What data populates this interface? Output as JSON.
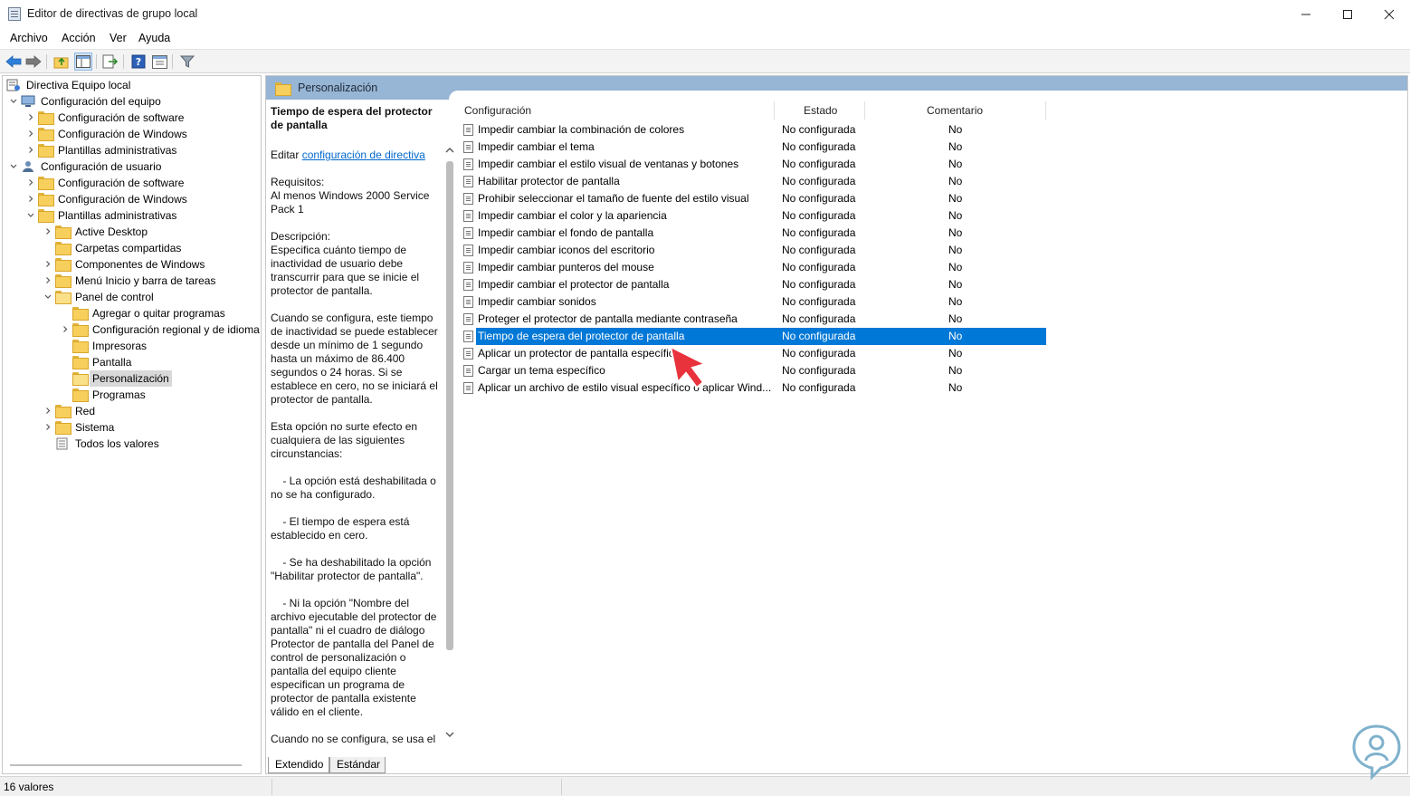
{
  "window": {
    "title": "Editor de directivas de grupo local"
  },
  "menu": [
    "Archivo",
    "Acción",
    "Ver",
    "Ayuda"
  ],
  "tree": [
    {
      "label": "Directiva Equipo local",
      "level": 0,
      "chevron": "",
      "icon": "policy-computer-icon"
    },
    {
      "label": "Configuración del equipo",
      "level": 1,
      "chevron": "down",
      "icon": "computer-icon"
    },
    {
      "label": "Configuración de software",
      "level": 2,
      "chevron": "right",
      "icon": "folder-icon"
    },
    {
      "label": "Configuración de Windows",
      "level": 2,
      "chevron": "right",
      "icon": "folder-icon"
    },
    {
      "label": "Plantillas administrativas",
      "level": 2,
      "chevron": "right",
      "icon": "folder-icon"
    },
    {
      "label": "Configuración de usuario",
      "level": 1,
      "chevron": "down",
      "icon": "user-icon"
    },
    {
      "label": "Configuración de software",
      "level": 2,
      "chevron": "right",
      "icon": "folder-icon"
    },
    {
      "label": "Configuración de Windows",
      "level": 2,
      "chevron": "right",
      "icon": "folder-icon"
    },
    {
      "label": "Plantillas administrativas",
      "level": 2,
      "chevron": "down",
      "icon": "folder-icon"
    },
    {
      "label": "Active Desktop",
      "level": 3,
      "chevron": "right",
      "icon": "folder-icon"
    },
    {
      "label": "Carpetas compartidas",
      "level": 3,
      "chevron": "",
      "icon": "folder-icon"
    },
    {
      "label": "Componentes de Windows",
      "level": 3,
      "chevron": "right",
      "icon": "folder-icon"
    },
    {
      "label": "Menú Inicio y barra de tareas",
      "level": 3,
      "chevron": "right",
      "icon": "folder-icon"
    },
    {
      "label": "Panel de control",
      "level": 3,
      "chevron": "down",
      "icon": "folder-open-icon"
    },
    {
      "label": "Agregar o quitar programas",
      "level": 4,
      "chevron": "",
      "icon": "folder-icon"
    },
    {
      "label": "Configuración regional y de idioma",
      "level": 4,
      "chevron": "right",
      "icon": "folder-icon"
    },
    {
      "label": "Impresoras",
      "level": 4,
      "chevron": "",
      "icon": "folder-icon"
    },
    {
      "label": "Pantalla",
      "level": 4,
      "chevron": "",
      "icon": "folder-icon"
    },
    {
      "label": "Personalización",
      "level": 4,
      "chevron": "",
      "icon": "folder-open-icon",
      "selected": true
    },
    {
      "label": "Programas",
      "level": 4,
      "chevron": "",
      "icon": "folder-icon"
    },
    {
      "label": "Red",
      "level": 3,
      "chevron": "right",
      "icon": "folder-icon"
    },
    {
      "label": "Sistema",
      "level": 3,
      "chevron": "right",
      "icon": "folder-icon"
    },
    {
      "label": "Todos los valores",
      "level": 3,
      "chevron": "",
      "icon": "all-settings-icon"
    }
  ],
  "header": {
    "title": "Personalización"
  },
  "description": {
    "title": "Tiempo de espera del protector de pantalla",
    "edit_prefix": "Editar ",
    "edit_link": "configuración de directiva",
    "requirements_label": "Requisitos:",
    "requirements": "Al menos Windows 2000 Service Pack 1",
    "description_label": "Descripción:",
    "p1": "Especifica cuánto tiempo de inactividad de usuario debe transcurrir para que se inicie el protector de pantalla.",
    "p2": "Cuando se configura, este tiempo de inactividad se puede establecer desde un mínimo de 1 segundo hasta un máximo de 86.400 segundos o 24 horas. Si se establece en cero, no se iniciará el protector de pantalla.",
    "p3": "Esta opción no surte efecto en cualquiera de las siguientes circunstancias:",
    "b1": "    - La opción está deshabilitada o no se ha configurado.",
    "b2": "    - El tiempo de espera está establecido en cero.",
    "b3": "    - Se ha deshabilitado la opción \"Habilitar protector de pantalla\".",
    "b4": "    - Ni la opción \"Nombre del archivo ejecutable del protector de pantalla\" ni el cuadro de diálogo Protector de pantalla del Panel de control de personalización o pantalla del equipo cliente especifican un programa de protector de pantalla existente válido en el cliente.",
    "p4": "Cuando no se configura, se usa el"
  },
  "columns": {
    "setting": "Configuración",
    "state": "Estado",
    "comment": "Comentario"
  },
  "rows": [
    {
      "setting": "Impedir cambiar la combinación de colores",
      "state": "No configurada",
      "comment": "No"
    },
    {
      "setting": "Impedir cambiar el tema",
      "state": "No configurada",
      "comment": "No"
    },
    {
      "setting": "Impedir cambiar el estilo visual de ventanas y botones",
      "state": "No configurada",
      "comment": "No"
    },
    {
      "setting": "Habilitar protector de pantalla",
      "state": "No configurada",
      "comment": "No"
    },
    {
      "setting": "Prohibir seleccionar el tamaño de fuente del estilo visual",
      "state": "No configurada",
      "comment": "No"
    },
    {
      "setting": "Impedir cambiar el color y la apariencia",
      "state": "No configurada",
      "comment": "No"
    },
    {
      "setting": "Impedir cambiar el fondo de pantalla",
      "state": "No configurada",
      "comment": "No"
    },
    {
      "setting": "Impedir cambiar iconos del escritorio",
      "state": "No configurada",
      "comment": "No"
    },
    {
      "setting": "Impedir cambiar punteros del mouse",
      "state": "No configurada",
      "comment": "No"
    },
    {
      "setting": "Impedir cambiar el protector de pantalla",
      "state": "No configurada",
      "comment": "No"
    },
    {
      "setting": "Impedir cambiar sonidos",
      "state": "No configurada",
      "comment": "No"
    },
    {
      "setting": "Proteger el protector de pantalla mediante contraseña",
      "state": "No configurada",
      "comment": "No"
    },
    {
      "setting": "Tiempo de espera del protector de pantalla",
      "state": "No configurada",
      "comment": "No",
      "selected": true
    },
    {
      "setting": "Aplicar un protector de pantalla específico",
      "state": "No configurada",
      "comment": "No"
    },
    {
      "setting": "Cargar un tema específico",
      "state": "No configurada",
      "comment": "No"
    },
    {
      "setting": "Aplicar un archivo de estilo visual específico o aplicar Wind...",
      "state": "No configurada",
      "comment": "No"
    }
  ],
  "tabs": {
    "extended": "Extendido",
    "standard": "Estándar"
  },
  "status": {
    "text": "16 valores"
  },
  "colors": {
    "selection": "#0078d7",
    "header": "#97b5d4",
    "cursor": "#e8323c"
  }
}
